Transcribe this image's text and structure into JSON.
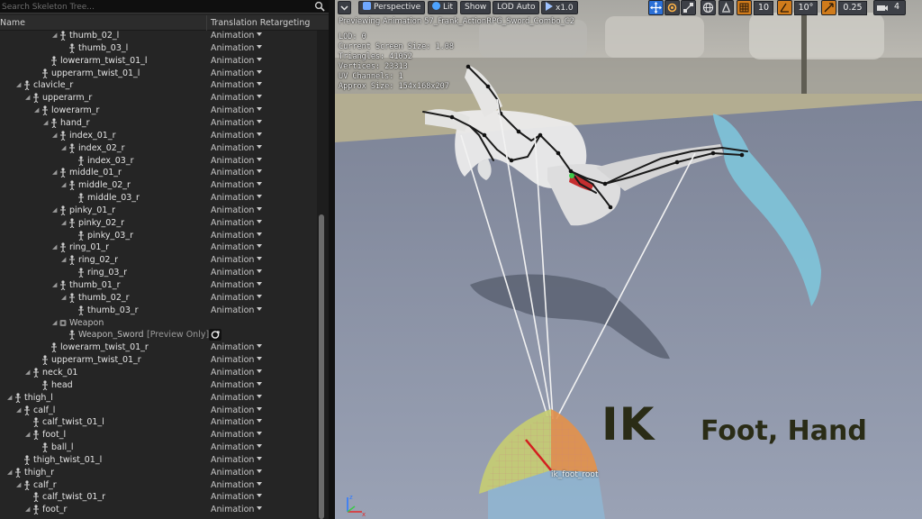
{
  "search": {
    "placeholder": "Search Skeleton Tree..."
  },
  "columns": {
    "name": "Name",
    "retargeting": "Translation Retargeting"
  },
  "bones": [
    {
      "label": "thumb_02_l",
      "level": 6,
      "expanded": true,
      "retarget": "Animation"
    },
    {
      "label": "thumb_03_l",
      "level": 7,
      "expanded": false,
      "retarget": "Animation"
    },
    {
      "label": "lowerarm_twist_01_l",
      "level": 5,
      "expanded": false,
      "retarget": "Animation"
    },
    {
      "label": "upperarm_twist_01_l",
      "level": 4,
      "expanded": false,
      "retarget": "Animation"
    },
    {
      "label": "clavicle_r",
      "level": 2,
      "expanded": true,
      "retarget": "Animation"
    },
    {
      "label": "upperarm_r",
      "level": 3,
      "expanded": true,
      "retarget": "Animation"
    },
    {
      "label": "lowerarm_r",
      "level": 4,
      "expanded": true,
      "retarget": "Animation"
    },
    {
      "label": "hand_r",
      "level": 5,
      "expanded": true,
      "retarget": "Animation"
    },
    {
      "label": "index_01_r",
      "level": 6,
      "expanded": true,
      "retarget": "Animation"
    },
    {
      "label": "index_02_r",
      "level": 7,
      "expanded": true,
      "retarget": "Animation"
    },
    {
      "label": "index_03_r",
      "level": 8,
      "expanded": false,
      "retarget": "Animation"
    },
    {
      "label": "middle_01_r",
      "level": 6,
      "expanded": true,
      "retarget": "Animation"
    },
    {
      "label": "middle_02_r",
      "level": 7,
      "expanded": true,
      "retarget": "Animation"
    },
    {
      "label": "middle_03_r",
      "level": 8,
      "expanded": false,
      "retarget": "Animation"
    },
    {
      "label": "pinky_01_r",
      "level": 6,
      "expanded": true,
      "retarget": "Animation"
    },
    {
      "label": "pinky_02_r",
      "level": 7,
      "expanded": true,
      "retarget": "Animation"
    },
    {
      "label": "pinky_03_r",
      "level": 8,
      "expanded": false,
      "retarget": "Animation"
    },
    {
      "label": "ring_01_r",
      "level": 6,
      "expanded": true,
      "retarget": "Animation"
    },
    {
      "label": "ring_02_r",
      "level": 7,
      "expanded": true,
      "retarget": "Animation"
    },
    {
      "label": "ring_03_r",
      "level": 8,
      "expanded": false,
      "retarget": "Animation"
    },
    {
      "label": "thumb_01_r",
      "level": 6,
      "expanded": true,
      "retarget": "Animation"
    },
    {
      "label": "thumb_02_r",
      "level": 7,
      "expanded": true,
      "retarget": "Animation"
    },
    {
      "label": "thumb_03_r",
      "level": 8,
      "expanded": false,
      "retarget": "Animation"
    },
    {
      "label": "Weapon",
      "level": 6,
      "expanded": true,
      "socket": true,
      "retarget": ""
    },
    {
      "label": "Weapon_Sword",
      "level": 7,
      "expanded": false,
      "asset": true,
      "preview": "[Preview Only]",
      "retarget": ""
    },
    {
      "label": "lowerarm_twist_01_r",
      "level": 5,
      "expanded": false,
      "retarget": "Animation"
    },
    {
      "label": "upperarm_twist_01_r",
      "level": 4,
      "expanded": false,
      "retarget": "Animation"
    },
    {
      "label": "neck_01",
      "level": 3,
      "expanded": true,
      "retarget": "Animation"
    },
    {
      "label": "head",
      "level": 4,
      "expanded": false,
      "retarget": "Animation"
    },
    {
      "label": "thigh_l",
      "level": 1,
      "expanded": true,
      "retarget": "Animation"
    },
    {
      "label": "calf_l",
      "level": 2,
      "expanded": true,
      "retarget": "Animation"
    },
    {
      "label": "calf_twist_01_l",
      "level": 3,
      "expanded": false,
      "retarget": "Animation"
    },
    {
      "label": "foot_l",
      "level": 3,
      "expanded": true,
      "retarget": "Animation"
    },
    {
      "label": "ball_l",
      "level": 4,
      "expanded": false,
      "retarget": "Animation"
    },
    {
      "label": "thigh_twist_01_l",
      "level": 2,
      "expanded": false,
      "retarget": "Animation"
    },
    {
      "label": "thigh_r",
      "level": 1,
      "expanded": true,
      "retarget": "Animation"
    },
    {
      "label": "calf_r",
      "level": 2,
      "expanded": true,
      "retarget": "Animation"
    },
    {
      "label": "calf_twist_01_r",
      "level": 3,
      "expanded": false,
      "retarget": "Animation"
    },
    {
      "label": "foot_r",
      "level": 3,
      "expanded": true,
      "retarget": "Animation"
    }
  ],
  "toolbar": {
    "perspective": "Perspective",
    "lit": "Lit",
    "show": "Show",
    "lod": "LOD Auto",
    "speed": "x1.0",
    "grid_snap": "10",
    "rotation_snap": "10°",
    "scale_snap": "0.25",
    "camera_speed": "4"
  },
  "stats": {
    "preview": "Previewing Animation 57_Frank_ActionRPG_Sword_Combo_C2",
    "lod": "LOD: 0",
    "screen_size": "Current Screen Size: 1.08",
    "triangles": "Triangles: 41052",
    "vertices": "Vertices: 23313",
    "uv": "UV Channels: 1",
    "approx": "Approx Size: 154x168x207"
  },
  "overlay": {
    "ik": "IK",
    "foot_hand": "Foot, Hand",
    "foot_bone": "ik_foot_root"
  },
  "colors": {
    "accent_blue": "#2b6fd6",
    "snap_orange": "#d07b1b",
    "floor": "#8f96a8",
    "overlay_text": "#2a2c16"
  }
}
